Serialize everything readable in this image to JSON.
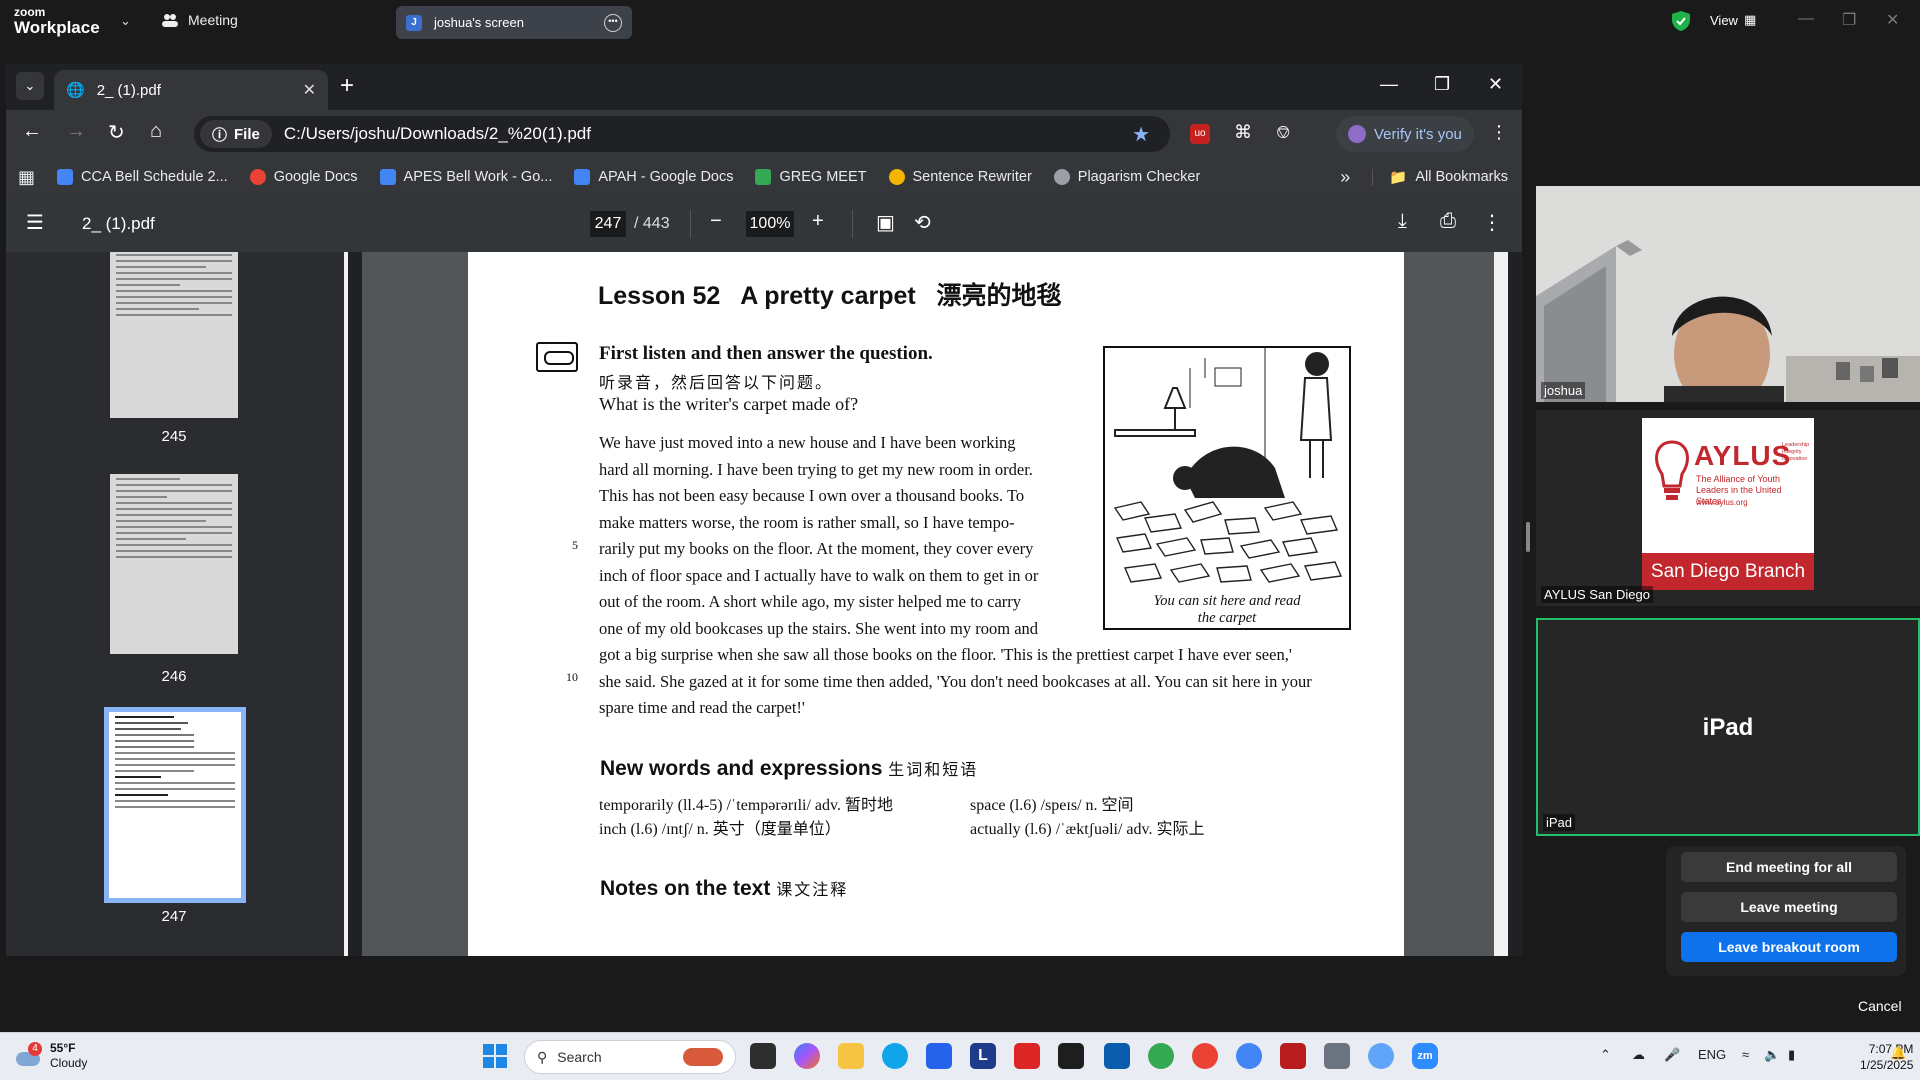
{
  "zoom": {
    "brand_top": "zoom",
    "brand_bottom": "Workplace",
    "meeting_label": "Meeting",
    "screen_tab_initial": "J",
    "screen_tab_label": "joshua's screen",
    "view_label": "View"
  },
  "browser": {
    "tab_title": "2_ (1).pdf",
    "file_chip": "File",
    "url": "C:/Users/joshu/Downloads/2_%20(1).pdf",
    "verify_label": "Verify it's you",
    "bookmarks": [
      {
        "label": "CCA Bell Schedule 2...",
        "color": "#4285f4"
      },
      {
        "label": "Google Docs",
        "color": "#ea4335"
      },
      {
        "label": "APES Bell Work - Go...",
        "color": "#4285f4"
      },
      {
        "label": "APAH - Google Docs",
        "color": "#4285f4"
      },
      {
        "label": "GREG MEET",
        "color": "#34a853"
      },
      {
        "label": "Sentence Rewriter",
        "color": "#f4b400"
      },
      {
        "label": "Plagarism Checker",
        "color": "#9aa0a6"
      }
    ],
    "more_bookmarks": "»",
    "all_bookmarks": "All Bookmarks"
  },
  "pdf": {
    "title": "2_ (1).pdf",
    "current_page": "247",
    "total_pages": "/ 443",
    "zoom": "100%",
    "thumbnails": [
      "245",
      "246",
      "247"
    ],
    "lesson_heading": "Lesson 52   A pretty carpet   漂亮的地毯",
    "instruction_en": "First listen and then answer the question.",
    "instruction_zh": "听录音，然后回答以下问题。",
    "question": "What is the writer's carpet made of?",
    "body_narrow": [
      "We have just moved into a new house and I have been working",
      "hard all morning. I have been trying to get my new room in order.",
      "This has not been easy because I own over a thousand books. To",
      "make matters worse, the room is rather small, so I have tempo-",
      "rarily put my books on the floor. At the moment, they cover every",
      "inch of floor space and I actually have to walk on them to get in or",
      "out of the room. A short while ago, my sister helped me to carry",
      "one of my old bookcases up the stairs. She went into my room and"
    ],
    "body_wide": [
      "got a big surprise when she saw all those books on the floor. 'This is the prettiest carpet I have ever seen,'",
      "she said. She gazed at it for some time then added, 'You don't need bookcases at all. You can sit here in your",
      "spare time and read the carpet!'"
    ],
    "line_5": "5",
    "line_10": "10",
    "caption_line1": "You can sit here and read",
    "caption_line2": "the carpet",
    "new_words_heading": "New words and expressions",
    "new_words_heading_zh": "生词和短语",
    "vocab_left": [
      "temporarily (ll.4-5) /ˈtempərərɪli/ adv. 暂时地",
      "inch (l.6) /ɪntʃ/ n. 英寸（度量单位）"
    ],
    "vocab_right": [
      "space (l.6) /speɪs/ n. 空间",
      "actually (l.6) /ˈæktʃuəli/ adv. 实际上"
    ],
    "notes_heading": "Notes on the text",
    "notes_heading_zh": "课文注释"
  },
  "participants": {
    "joshua": "joshua",
    "aylus_card_title": "AYLUS",
    "aylus_card_sub": "The Alliance of Youth Leaders in the United States",
    "aylus_card_tagline": "Leadership Integrity Innovation",
    "aylus_card_url": "www.aylus.org",
    "aylus_card_branch": "San Diego Branch",
    "aylus_label": "AYLUS San Diego",
    "ipad_name": "iPad",
    "ipad_label": "iPad"
  },
  "leave_menu": {
    "end_for_all": "End meeting for all",
    "leave_meeting": "Leave meeting",
    "leave_breakout": "Leave breakout room",
    "cancel": "Cancel",
    "accent": "#0e72ed"
  },
  "taskbar": {
    "weather_badge": "4",
    "temperature": "55°F",
    "condition": "Cloudy",
    "search_placeholder": "Search",
    "lang": "ENG",
    "time": "7:07 PM",
    "date": "1/25/2025"
  }
}
